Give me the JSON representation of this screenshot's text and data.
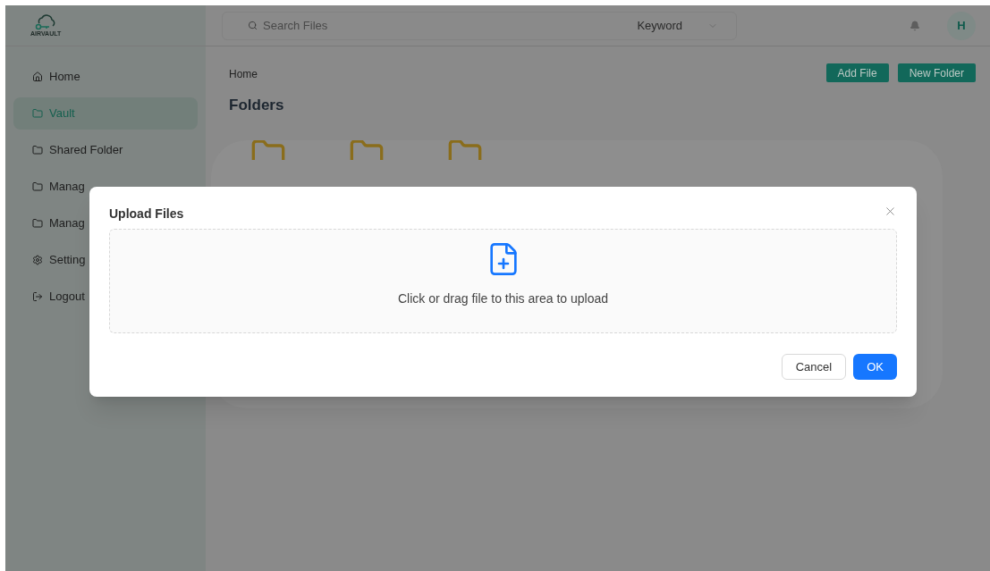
{
  "logo": {
    "text": "AIRVAULT"
  },
  "search": {
    "placeholder": "Search Files",
    "filter": "Keyword"
  },
  "user": {
    "initial": "H"
  },
  "sidebar": {
    "items": [
      {
        "label": "Home",
        "kind": "home",
        "selected": false
      },
      {
        "label": "Vault",
        "kind": "folder",
        "selected": true
      },
      {
        "label": "Shared Folder",
        "kind": "folder",
        "selected": false
      },
      {
        "label": "Manag",
        "kind": "folder",
        "selected": false
      },
      {
        "label": "Manag",
        "kind": "folder",
        "selected": false
      },
      {
        "label": "Setting",
        "kind": "settings",
        "selected": false
      },
      {
        "label": "Logout",
        "kind": "logout",
        "selected": false
      }
    ]
  },
  "breadcrumb": "Home",
  "actions": [
    "Add File",
    "New Folder"
  ],
  "section_title": "Folders",
  "folders": [
    {
      "kind": "folder"
    },
    {
      "kind": "folder"
    },
    {
      "kind": "folder"
    }
  ],
  "dialog": {
    "title": "Upload Files",
    "dropzone_text": "Click or drag file to this area to upload",
    "buttons": [
      {
        "label": "Cancel",
        "kind": "default"
      },
      {
        "label": "OK",
        "kind": "primary"
      }
    ]
  }
}
